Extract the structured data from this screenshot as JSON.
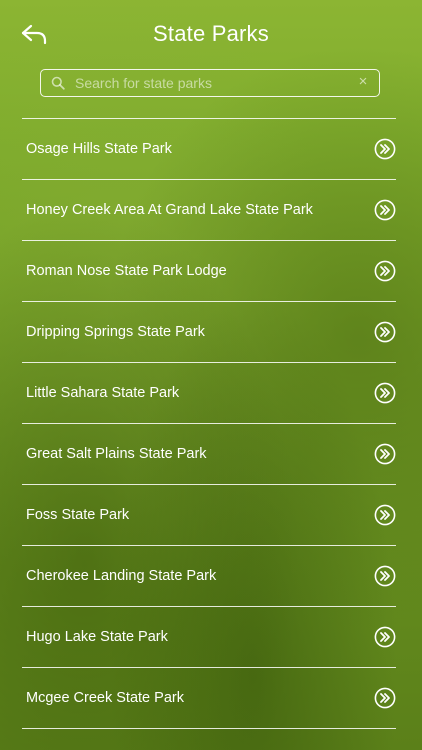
{
  "header": {
    "title": "State Parks",
    "back_icon": "back-arrow-icon"
  },
  "search": {
    "placeholder": "Search for state parks",
    "value": "",
    "clear_symbol": "×"
  },
  "parks": [
    {
      "label": "Osage Hills State Park"
    },
    {
      "label": "Honey Creek Area At Grand Lake State Park"
    },
    {
      "label": "Roman Nose State Park Lodge"
    },
    {
      "label": "Dripping Springs State Park"
    },
    {
      "label": "Little Sahara State Park"
    },
    {
      "label": "Great Salt Plains State Park"
    },
    {
      "label": "Foss State Park"
    },
    {
      "label": "Cherokee Landing State Park"
    },
    {
      "label": "Hugo Lake State Park"
    },
    {
      "label": "Mcgee Creek State Park"
    }
  ],
  "colors": {
    "background": "#76a127",
    "text": "#ffffff"
  }
}
